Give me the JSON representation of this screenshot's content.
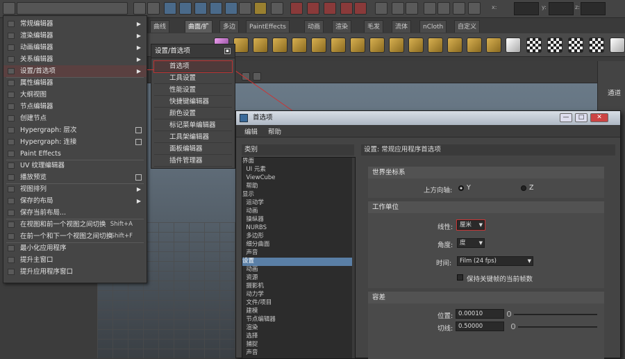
{
  "toolbar": {
    "fields": [
      "",
      "",
      ""
    ],
    "field_labels": [
      "x:",
      "y:",
      "z:"
    ]
  },
  "shelf": {
    "tabs": [
      "曲线",
      "曲面/扩",
      "多边",
      "PaintEffects",
      "动画",
      "渲染",
      "毛发",
      "流体",
      "nCloth",
      "自定义"
    ],
    "active_tab": 1
  },
  "right_panel": {
    "label": "通道"
  },
  "main_menu": {
    "items": [
      {
        "label": "常规编辑器",
        "arrow": true
      },
      {
        "label": "渲染编辑器",
        "arrow": true
      },
      {
        "label": "动画编辑器",
        "arrow": true
      },
      {
        "label": "关系编辑器",
        "arrow": true
      },
      {
        "label": "设置/首选项",
        "arrow": true,
        "hl": true
      },
      {
        "label": "属性编辑器"
      },
      {
        "label": "大纲视图"
      },
      {
        "label": "节点编辑器"
      },
      {
        "label": "创建节点"
      },
      {
        "label": "Hypergraph: 层次",
        "box": true
      },
      {
        "label": "Hypergraph: 连接",
        "box": true
      },
      {
        "label": "Paint Effects"
      },
      {
        "label": "UV 纹理编辑器"
      },
      {
        "label": "播放预览",
        "box": true
      },
      {
        "label": "视图排列",
        "arrow": true
      },
      {
        "label": "保存的布局",
        "arrow": true
      },
      {
        "label": "保存当前布局..."
      },
      {
        "label": "在视图和前一个视图之间切换",
        "short": "Shift+A"
      },
      {
        "label": "在前一个和下一个视图之间切换",
        "short": "Shift+F"
      },
      {
        "label": "最小化应用程序"
      },
      {
        "label": "提升主窗口"
      },
      {
        "label": "提升应用程序窗口"
      }
    ]
  },
  "sub_menu": {
    "title": "设置/首选项",
    "items": [
      {
        "label": "首选项",
        "hl": true
      },
      {
        "label": "工具设置"
      },
      {
        "label": "性能设置"
      },
      {
        "label": "快捷键编辑器"
      },
      {
        "label": "颜色设置"
      },
      {
        "label": "标记菜单编辑器"
      },
      {
        "label": "工具架编辑器"
      },
      {
        "label": "面板编辑器"
      },
      {
        "label": "插件管理器"
      }
    ]
  },
  "prefs": {
    "title": "首选项",
    "menu": [
      "编辑",
      "帮助"
    ],
    "categories_header": "类别",
    "categories": [
      "界面",
      "  UI 元素",
      "  ViewCube",
      "  帮助",
      "显示",
      "  运动学",
      "  动画",
      "  操纵器",
      "  NURBS",
      "  多边形",
      "  细分曲面",
      "  声音",
      "设置",
      "  动画",
      "  资源",
      "  摄影机",
      "  动力学",
      "  文件/项目",
      "  建模",
      "  节点编辑器",
      "  渲染",
      "  选择",
      "  捕捉",
      "  声音"
    ],
    "selected_category": 12,
    "settings_title": "设置: 常规应用程序首选项",
    "world_section": "世界坐标系",
    "up_axis_label": "上方向轴:",
    "up_axis_options": [
      "Y",
      "Z"
    ],
    "up_axis_selected": 0,
    "units_section": "工作单位",
    "linear_label": "线性:",
    "linear_value": "厘米",
    "angular_label": "角度:",
    "angular_value": "度",
    "time_label": "时间:",
    "time_value": "Film (24 fps)",
    "keep_keys_label": "保持关键帧的当前帧数",
    "tolerance_section": "容差",
    "positional_label": "位置:",
    "positional_value": "0.00010",
    "tangential_label": "切线:",
    "tangential_value": "0.50000"
  }
}
